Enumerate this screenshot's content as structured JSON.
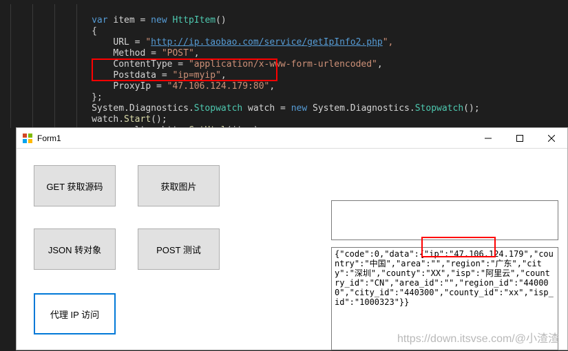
{
  "code": {
    "line1_var": "var",
    "line1_item": "item",
    "line1_eq": " = ",
    "line1_new": "new",
    "line1_httpitem": "HttpItem",
    "line1_end": "()",
    "line2": "{",
    "line3_url": "URL = ",
    "line3_quote1": "\"",
    "line3_link": "http://ip.taobao.com/service/getIpInfo2.php",
    "line3_end": "\",",
    "line4_method": "Method = ",
    "line4_val": "\"POST\"",
    "line4_end": ",",
    "line5_ct": "ContentType = ",
    "line5_val": "\"application/x-www-form-urlencoded\"",
    "line5_end": ",",
    "line6_pd": "Postdata = ",
    "line6_val": "\"ip=myip\"",
    "line6_end": ",",
    "line7_proxy": "ProxyIp = ",
    "line7_val": "\"47.106.124.179:80\"",
    "line7_end": ",",
    "line8": "};",
    "line9_a": "System.Diagnostics.",
    "line9_sw": "Stopwatch",
    "line9_b": " watch = ",
    "line9_new": "new",
    "line9_c": " System.Diagnostics.",
    "line9_sw2": "Stopwatch",
    "line9_d": "();",
    "line10_a": "watch.",
    "line10_start": "Start",
    "line10_b": "();",
    "line11_var": "var",
    "line11_a": " result = http.",
    "line11_gh": "GetHtml",
    "line11_b": "(item);"
  },
  "window": {
    "title": "Form1",
    "buttons": {
      "get_source": "GET 获取源码",
      "get_image": "获取图片",
      "json_to_obj": "JSON 转对象",
      "post_test": "POST 测试",
      "proxy_ip": "代理 IP 访问"
    },
    "textbox1": "",
    "textbox2": "{\"code\":0,\"data\":{\"ip\":\"47.106.124.179\",\"country\":\"中国\",\"area\":\"\",\"region\":\"广东\",\"city\":\"深圳\",\"county\":\"XX\",\"isp\":\"阿里云\",\"country_id\":\"CN\",\"area_id\":\"\",\"region_id\":\"440000\",\"city_id\":\"440300\",\"county_id\":\"xx\",\"isp_id\":\"1000323\"}}"
  },
  "watermark": "https://down.itsvse.com/@小渣渣"
}
